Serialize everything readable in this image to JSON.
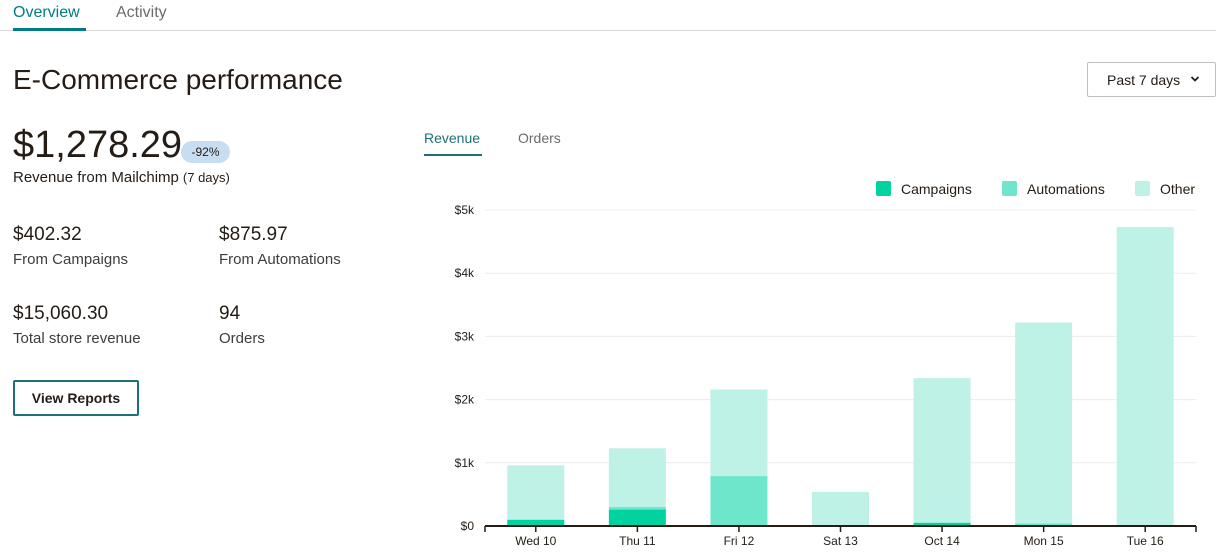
{
  "top_tabs": [
    {
      "label": "Overview",
      "active": true
    },
    {
      "label": "Activity",
      "active": false
    }
  ],
  "page_title": "E-Commerce performance",
  "range_select": {
    "value": "Past 7 days",
    "icon": "chevron-down-icon"
  },
  "kpi": {
    "value": "$1,278.29",
    "change": "-92%",
    "label": "Revenue from Mailchimp",
    "period": "(7 days)"
  },
  "stats": [
    {
      "value": "$402.32",
      "label": "From Campaigns"
    },
    {
      "value": "$875.97",
      "label": "From Automations"
    },
    {
      "value": "$15,060.30",
      "label": "Total store revenue"
    },
    {
      "value": "94",
      "label": "Orders"
    }
  ],
  "view_reports_label": "View Reports",
  "chart_tabs": [
    {
      "label": "Revenue",
      "active": true
    },
    {
      "label": "Orders",
      "active": false
    }
  ],
  "colors": {
    "campaigns": "#00d2a0",
    "automations": "#6ee6cb",
    "other": "#bff2e6",
    "accent": "#007c89"
  },
  "chart_data": {
    "type": "bar",
    "stacked": true,
    "categories": [
      "Wed 10",
      "Thu 11",
      "Fri 12",
      "Sat 13",
      "Oct 14",
      "Mon 15",
      "Tue 16"
    ],
    "series": [
      {
        "name": "Campaigns",
        "values": [
          100,
          260,
          0,
          0,
          50,
          0,
          0
        ]
      },
      {
        "name": "Automations",
        "values": [
          0,
          40,
          790,
          0,
          10,
          40,
          0
        ]
      },
      {
        "name": "Other",
        "values": [
          860,
          930,
          1370,
          540,
          2280,
          3180,
          4730
        ]
      }
    ],
    "yticks": [
      "$0",
      "$1k",
      "$2k",
      "$3k",
      "$4k",
      "$5k"
    ],
    "ylim": [
      0,
      5000
    ],
    "grid": true,
    "legend_position": "top-right"
  }
}
